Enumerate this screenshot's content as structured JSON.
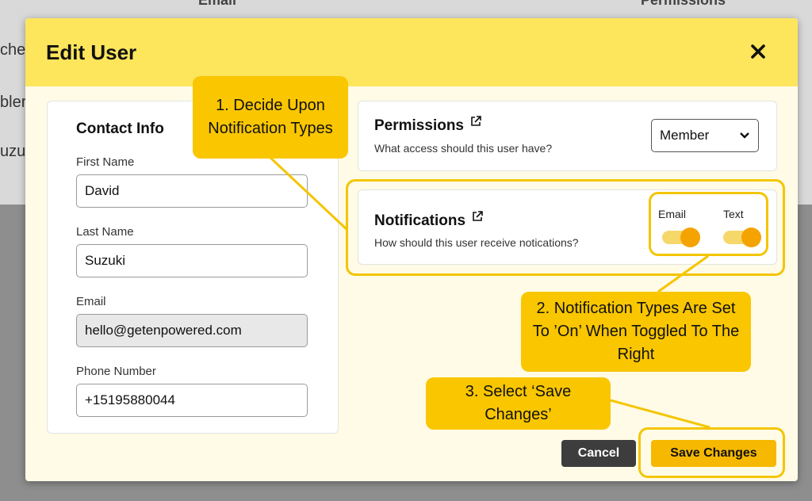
{
  "background": {
    "left_texts": [
      "che",
      "bler",
      "uzu"
    ],
    "col_email": "Email",
    "col_permissions": "Permissions"
  },
  "modal": {
    "title": "Edit User",
    "close_icon": "close-icon"
  },
  "contact": {
    "title": "Contact Info",
    "first_name_label": "First Name",
    "first_name_value": "David",
    "last_name_label": "Last Name",
    "last_name_value": "Suzuki",
    "email_label": "Email",
    "email_value": "hello@getenpowered.com",
    "phone_label": "Phone Number",
    "phone_value": "+15195880044"
  },
  "permissions": {
    "title": "Permissions",
    "subtitle": "What access should this user have?",
    "selected": "Member",
    "icon": "external-link-icon"
  },
  "notifications": {
    "title": "Notifications",
    "subtitle": "How should this user receive notications?",
    "icon": "external-link-icon",
    "email_label": "Email",
    "email_on": true,
    "text_label": "Text",
    "text_on": true
  },
  "buttons": {
    "cancel": "Cancel",
    "save": "Save Changes"
  },
  "annotations": {
    "callout1": "1. Decide Upon Notification Types",
    "callout2": "2. Notification Types Are Set To ’On’ When Toggled To The Right",
    "callout3": "3. Select ‘Save Changes’"
  },
  "colors": {
    "header": "#fde55c",
    "accent": "#f6b800",
    "toggle_knob": "#f4a300",
    "callout": "#f9c600"
  }
}
